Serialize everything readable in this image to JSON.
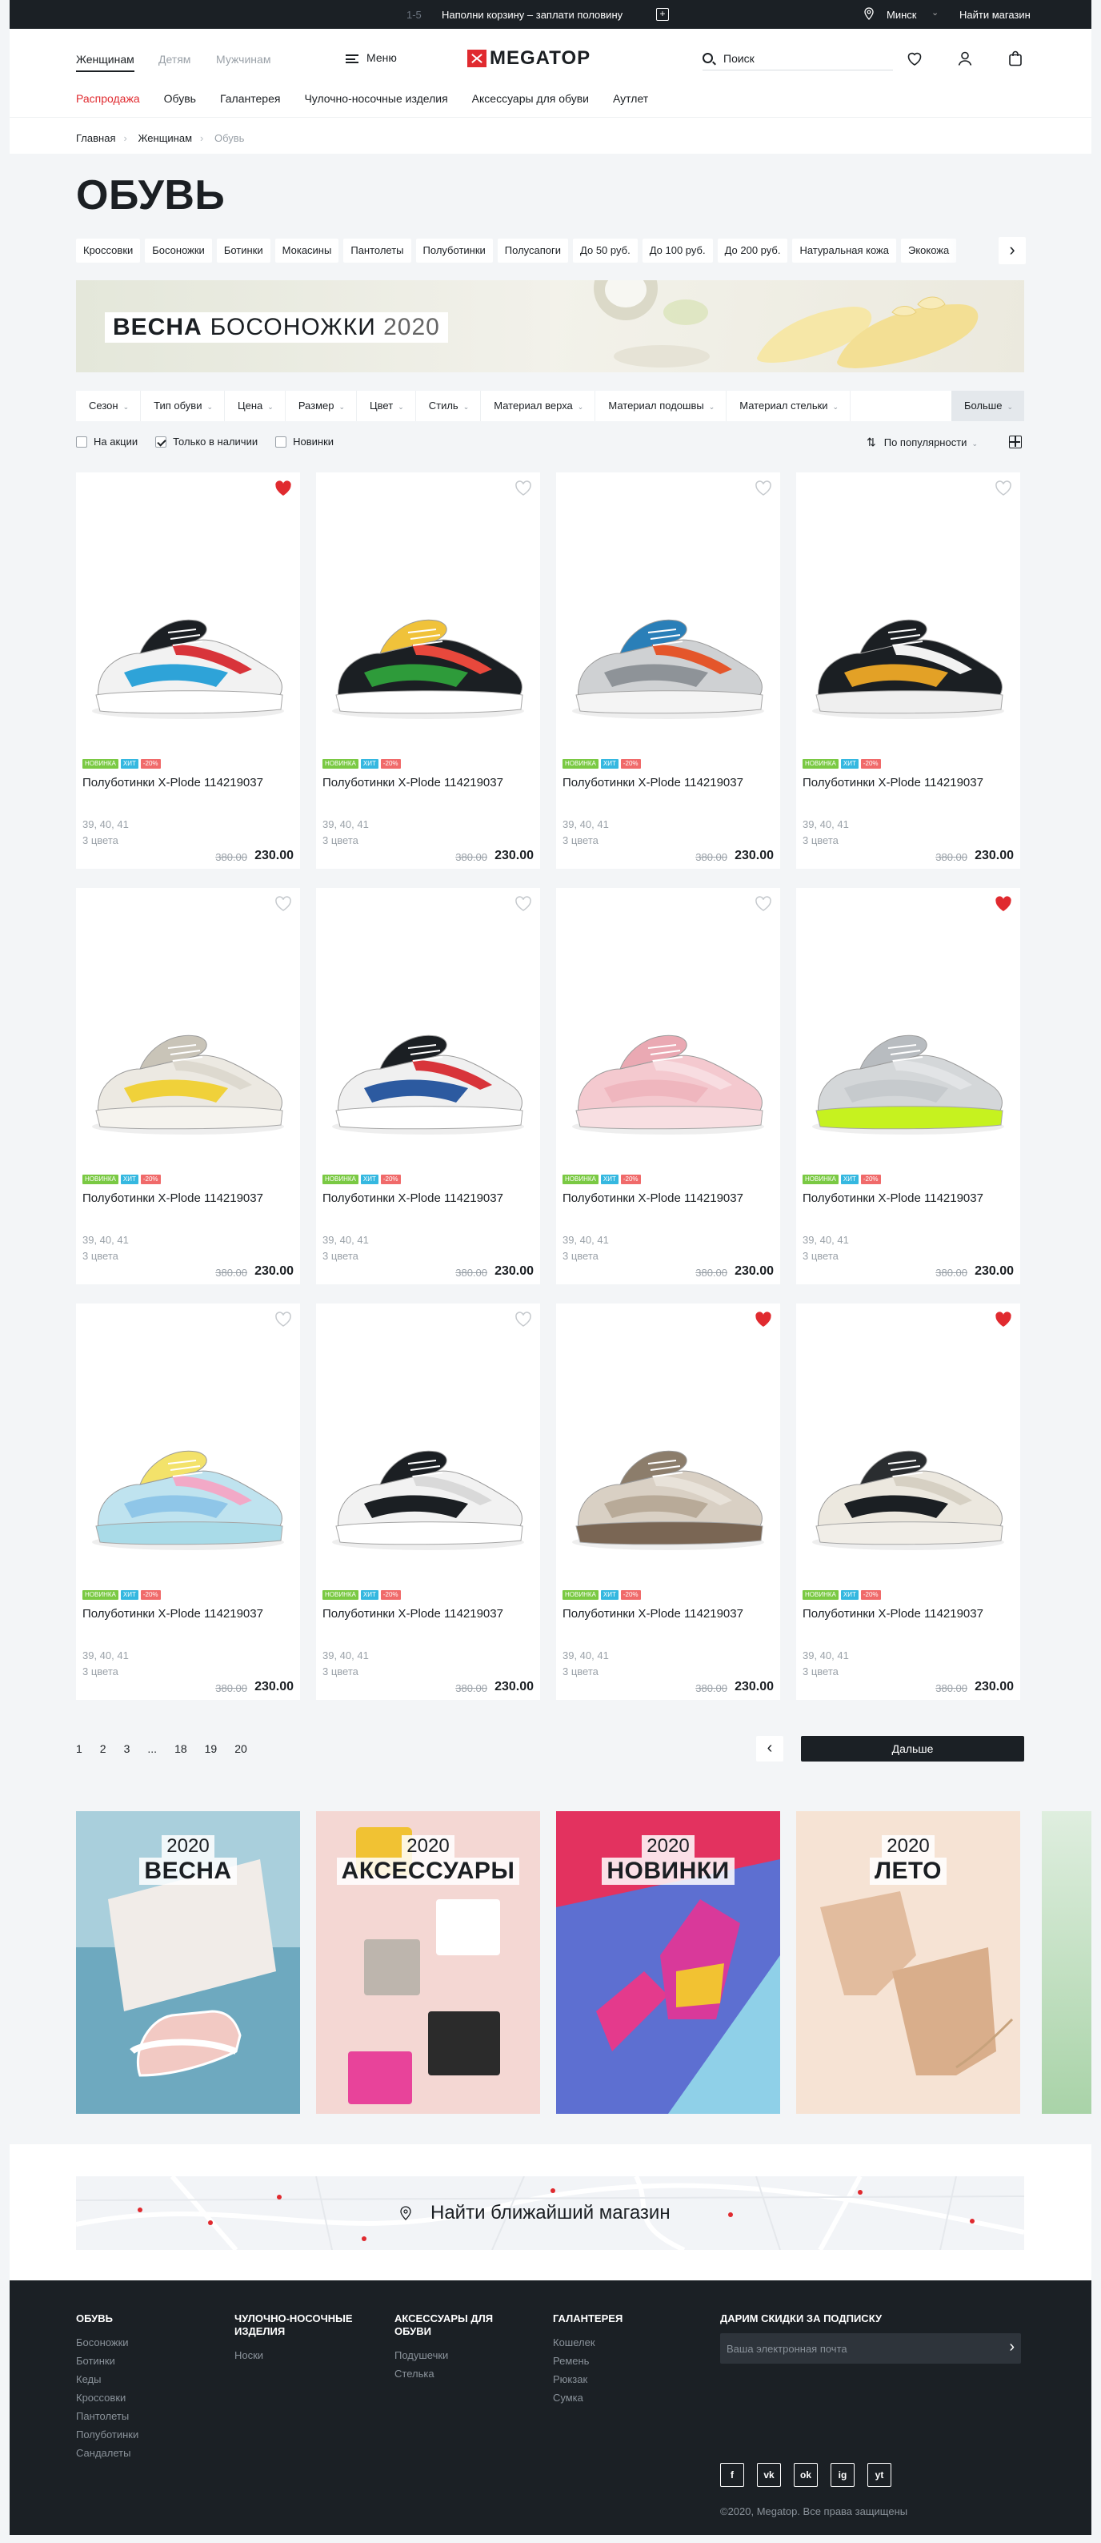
{
  "promo": {
    "counter": "1-5",
    "text": "Наполни корзину – заплати половину",
    "plus": "+",
    "city": "Минск",
    "find_store": "Найти магазин"
  },
  "header": {
    "gender_tabs": [
      "Женщинам",
      "Детям",
      "Мужчинам"
    ],
    "menu_label": "Меню",
    "logo_text": "MEGATOP",
    "search_placeholder": "Поиск",
    "categories": [
      "Распродажа",
      "Обувь",
      "Галантерея",
      "Чулочно-носочные изделия",
      "Аксессуары для обуви",
      "Аутлет"
    ]
  },
  "breadcrumbs": [
    "Главная",
    "Женщинам",
    "Обувь"
  ],
  "page_title": "ОБУВЬ",
  "chips": [
    "Кроссовки",
    "Босоножки",
    "Ботинки",
    "Мокасины",
    "Пантолеты",
    "Полуботинки",
    "Полусапоги",
    "До 50 руб.",
    "До 100 руб.",
    "До 200 руб.",
    "Натуральная кожа",
    "Экокожа"
  ],
  "banner": {
    "word1": "ВЕСНА",
    "word2": "БОСОНОЖКИ",
    "year": "2020"
  },
  "filters": [
    "Сезон",
    "Тип обуви",
    "Цена",
    "Размер",
    "Цвет",
    "Стиль",
    "Материал верха",
    "Материал подошвы",
    "Материал стельки"
  ],
  "filters_more": "Больше",
  "checkboxes": [
    {
      "label": "На акции",
      "checked": false
    },
    {
      "label": "Только в наличии",
      "checked": true
    },
    {
      "label": "Новинки",
      "checked": false
    }
  ],
  "sort_label": "По популярности",
  "badges": {
    "new": "НОВИНКА",
    "hit": "ХИТ",
    "sale": "-20%"
  },
  "products": [
    {
      "name": "Полуботинки X-Plode 114219037",
      "sizes": "39, 40, 41",
      "colors": "3 цвета",
      "old_price": "380.00",
      "price": "230.00",
      "favorite": true,
      "shoe": {
        "base": "#f2f2f2",
        "a": "#2ea3d8",
        "b": "#d8343a",
        "c": "#1b1f23",
        "sole": "#ffffff"
      }
    },
    {
      "name": "Полуботинки X-Plode 114219037",
      "sizes": "39, 40, 41",
      "colors": "3 цвета",
      "old_price": "380.00",
      "price": "230.00",
      "favorite": false,
      "shoe": {
        "base": "#1b1f23",
        "a": "#2e9b3a",
        "b": "#e8483c",
        "c": "#f0c23a",
        "sole": "#ffffff"
      }
    },
    {
      "name": "Полуботинки X-Plode 114219037",
      "sizes": "39, 40, 41",
      "colors": "3 цвета",
      "old_price": "380.00",
      "price": "230.00",
      "favorite": false,
      "shoe": {
        "base": "#cfd1d3",
        "a": "#8e9398",
        "b": "#e4562b",
        "c": "#2a7fb8",
        "sole": "#f4f4f4"
      }
    },
    {
      "name": "Полуботинки X-Plode 114219037",
      "sizes": "39, 40, 41",
      "colors": "3 цвета",
      "old_price": "380.00",
      "price": "230.00",
      "favorite": false,
      "shoe": {
        "base": "#1b1f23",
        "a": "#e3a126",
        "b": "#f2f2f2",
        "c": "#1b1f23",
        "sole": "#efefef"
      }
    },
    {
      "name": "Полуботинки X-Plode 114219037",
      "sizes": "39, 40, 41",
      "colors": "3 цвета",
      "old_price": "380.00",
      "price": "230.00",
      "favorite": false,
      "shoe": {
        "base": "#ece9e2",
        "a": "#f0d13a",
        "b": "#ddd9cf",
        "c": "#c9c4b8",
        "sole": "#f5f3ee"
      }
    },
    {
      "name": "Полуботинки X-Plode 114219037",
      "sizes": "39, 40, 41",
      "colors": "3 цвета",
      "old_price": "380.00",
      "price": "230.00",
      "favorite": false,
      "shoe": {
        "base": "#f0f0f0",
        "a": "#2c5aa0",
        "b": "#d8343a",
        "c": "#1b1f23",
        "sole": "#ffffff"
      }
    },
    {
      "name": "Полуботинки X-Plode 114219037",
      "sizes": "39, 40, 41",
      "colors": "3 цвета",
      "old_price": "380.00",
      "price": "230.00",
      "favorite": false,
      "shoe": {
        "base": "#f4c9cf",
        "a": "#efb6be",
        "b": "#f8dde1",
        "c": "#eaa9b3",
        "sole": "#f8dfe2"
      }
    },
    {
      "name": "Полуботинки X-Plode 114219037",
      "sizes": "39, 40, 41",
      "colors": "3 цвета",
      "old_price": "380.00",
      "price": "230.00",
      "favorite": true,
      "shoe": {
        "base": "#d4d7d9",
        "a": "#c6cacd",
        "b": "#e2e4e6",
        "c": "#b8bcc0",
        "sole": "#c6f21f"
      }
    },
    {
      "name": "Полуботинки X-Plode 114219037",
      "sizes": "39, 40, 41",
      "colors": "3 цвета",
      "old_price": "380.00",
      "price": "230.00",
      "favorite": false,
      "shoe": {
        "base": "#bfe3ef",
        "a": "#8fc6e8",
        "b": "#f2a9c7",
        "c": "#f3e26a",
        "sole": "#a9dbe8"
      }
    },
    {
      "name": "Полуботинки X-Plode 114219037",
      "sizes": "39, 40, 41",
      "colors": "3 цвета",
      "old_price": "380.00",
      "price": "230.00",
      "favorite": false,
      "shoe": {
        "base": "#f2f2f2",
        "a": "#1b1f23",
        "b": "#d9d9d9",
        "c": "#1b1f23",
        "sole": "#ffffff"
      }
    },
    {
      "name": "Полуботинки X-Plode 114219037",
      "sizes": "39, 40, 41",
      "colors": "3 цвета",
      "old_price": "380.00",
      "price": "230.00",
      "favorite": true,
      "shoe": {
        "base": "#d9d0c4",
        "a": "#b8aa98",
        "b": "#e8e2d9",
        "c": "#8c7d6b",
        "sole": "#7a6654"
      }
    },
    {
      "name": "Полуботинки X-Plode 114219037",
      "sizes": "39, 40, 41",
      "colors": "3 цвета",
      "old_price": "380.00",
      "price": "230.00",
      "favorite": true,
      "shoe": {
        "base": "#ece8df",
        "a": "#1b1f23",
        "b": "#d6d0c3",
        "c": "#2a2d30",
        "sole": "#f1eee8"
      }
    }
  ],
  "pagination": {
    "pages": [
      "1",
      "2",
      "3",
      "...",
      "18",
      "19",
      "20"
    ],
    "prev": "‹",
    "next_label": "Дальше"
  },
  "tiles": [
    {
      "year": "2020",
      "title": "ВЕСНА",
      "bg1": "#a9cfdc",
      "bg2": "#6ea9bf"
    },
    {
      "year": "2020",
      "title": "АКСЕССУАРЫ",
      "bg1": "#f4d7d3",
      "bg2": "#efc8c3"
    },
    {
      "year": "2020",
      "title": "НОВИНКИ",
      "bg1": "#e3325f",
      "bg2": "#5d6fd1"
    },
    {
      "year": "2020",
      "title": "ЛЕТО",
      "bg1": "#f6e3d4",
      "bg2": "#f3d9c6"
    }
  ],
  "map_label": "Найти ближайший магазин",
  "footer": {
    "columns": [
      {
        "title": "ОБУВЬ",
        "links": [
          "Босоножки",
          "Ботинки",
          "Кеды",
          "Кроссовки",
          "Пантолеты",
          "Полуботинки",
          "Сандалеты"
        ]
      },
      {
        "title": "ЧУЛОЧНО-НОСОЧНЫЕ ИЗДЕЛИЯ",
        "links": [
          "Носки"
        ]
      },
      {
        "title": "АКСЕССУАРЫ ДЛЯ ОБУВИ",
        "links": [
          "Подушечки",
          "Стелька"
        ]
      },
      {
        "title": "ГАЛАНТЕРЕЯ",
        "links": [
          "Кошелек",
          "Ремень",
          "Рюкзак",
          "Сумка"
        ]
      }
    ],
    "subscribe_title": "ДАРИМ СКИДКИ ЗА ПОДПИСКУ",
    "email_placeholder": "Ваша электронная почта",
    "socials": [
      "f",
      "vk",
      "ok",
      "ig",
      "yt"
    ],
    "copyright": "©2020, Megatop. Все права защищены"
  },
  "colors": {
    "accent": "#e02a2f",
    "dark": "#1b2025",
    "heart_active": "#e02a2f"
  }
}
